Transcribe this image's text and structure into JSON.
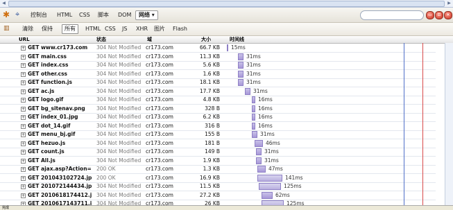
{
  "toolbar": {
    "tabs": [
      "控制台",
      "HTML",
      "CSS",
      "脚本",
      "DOM",
      "网络"
    ],
    "active_tab_label": "网络 ▾",
    "search_placeholder": ""
  },
  "filter_bar": {
    "clear_label": "清除",
    "persist_label": "保持",
    "filters": [
      "所有",
      "HTML",
      "CSS",
      "JS",
      "XHR",
      "图片",
      "Flash"
    ]
  },
  "columns": {
    "url": "URL",
    "status": "状态",
    "domain": "域",
    "size": "大小",
    "timeline": "时间线"
  },
  "rows": [
    {
      "url": "GET www.cr173.com",
      "status": "304 Not Modified",
      "domain": "cr173.com",
      "size": "66.7 KB",
      "time": "15ms",
      "bar_start": 0,
      "bar_len": 1
    },
    {
      "url": "GET main.css",
      "status": "304 Not Modified",
      "domain": "cr173.com",
      "size": "11.3 KB",
      "time": "31ms",
      "bar_start": 16,
      "bar_len": 8
    },
    {
      "url": "GET index.css",
      "status": "304 Not Modified",
      "domain": "cr173.com",
      "size": "5.6 KB",
      "time": "31ms",
      "bar_start": 16,
      "bar_len": 8
    },
    {
      "url": "GET other.css",
      "status": "304 Not Modified",
      "domain": "cr173.com",
      "size": "1.6 KB",
      "time": "31ms",
      "bar_start": 16,
      "bar_len": 8
    },
    {
      "url": "GET function.js",
      "status": "304 Not Modified",
      "domain": "cr173.com",
      "size": "18.1 KB",
      "time": "31ms",
      "bar_start": 16,
      "bar_len": 8
    },
    {
      "url": "GET ac.js",
      "status": "304 Not Modified",
      "domain": "cr173.com",
      "size": "17.7 KB",
      "time": "31ms",
      "bar_start": 26,
      "bar_len": 8
    },
    {
      "url": "GET logo.gif",
      "status": "304 Not Modified",
      "domain": "cr173.com",
      "size": "4.8 KB",
      "time": "16ms",
      "bar_start": 36,
      "bar_len": 5
    },
    {
      "url": "GET bg_sitenav.png",
      "status": "304 Not Modified",
      "domain": "cr173.com",
      "size": "328 B",
      "time": "16ms",
      "bar_start": 36,
      "bar_len": 5
    },
    {
      "url": "GET index_01.jpg",
      "status": "304 Not Modified",
      "domain": "cr173.com",
      "size": "6.2 KB",
      "time": "16ms",
      "bar_start": 36,
      "bar_len": 5
    },
    {
      "url": "GET dot_14.gif",
      "status": "304 Not Modified",
      "domain": "cr173.com",
      "size": "316 B",
      "time": "16ms",
      "bar_start": 36,
      "bar_len": 5
    },
    {
      "url": "GET menu_bj.gif",
      "status": "304 Not Modified",
      "domain": "cr173.com",
      "size": "155 B",
      "time": "31ms",
      "bar_start": 36,
      "bar_len": 8
    },
    {
      "url": "GET hezuo.js",
      "status": "304 Not Modified",
      "domain": "cr173.com",
      "size": "181 B",
      "time": "46ms",
      "bar_start": 40,
      "bar_len": 12
    },
    {
      "url": "GET count.js",
      "status": "304 Not Modified",
      "domain": "cr173.com",
      "size": "149 B",
      "time": "31ms",
      "bar_start": 42,
      "bar_len": 8
    },
    {
      "url": "GET All.js",
      "status": "304 Not Modified",
      "domain": "cr173.com",
      "size": "1.9 KB",
      "time": "31ms",
      "bar_start": 42,
      "bar_len": 8
    },
    {
      "url": "GET ajax.asp?Action=",
      "status": "200 OK",
      "domain": "cr173.com",
      "size": "1.3 KB",
      "time": "47ms",
      "bar_start": 44,
      "bar_len": 12
    },
    {
      "url": "GET 201043102724.jp",
      "status": "200 OK",
      "domain": "cr173.com",
      "size": "16.9 KB",
      "time": "141ms",
      "bar_start": 44,
      "bar_len": 36
    },
    {
      "url": "GET 201072144434.jp",
      "status": "304 Not Modified",
      "domain": "cr173.com",
      "size": "11.5 KB",
      "time": "125ms",
      "bar_start": 46,
      "bar_len": 32
    },
    {
      "url": "GET 2010618174412.j",
      "status": "304 Not Modified",
      "domain": "cr173.com",
      "size": "27.2 KB",
      "time": "62ms",
      "bar_start": 50,
      "bar_len": 16
    },
    {
      "url": "GET 2010617143711.j",
      "status": "304 Not Modified",
      "domain": "cr173.com",
      "size": "26 KB",
      "time": "125ms",
      "bar_start": 50,
      "bar_len": 32
    }
  ],
  "statusbar": {
    "text": "完成"
  }
}
